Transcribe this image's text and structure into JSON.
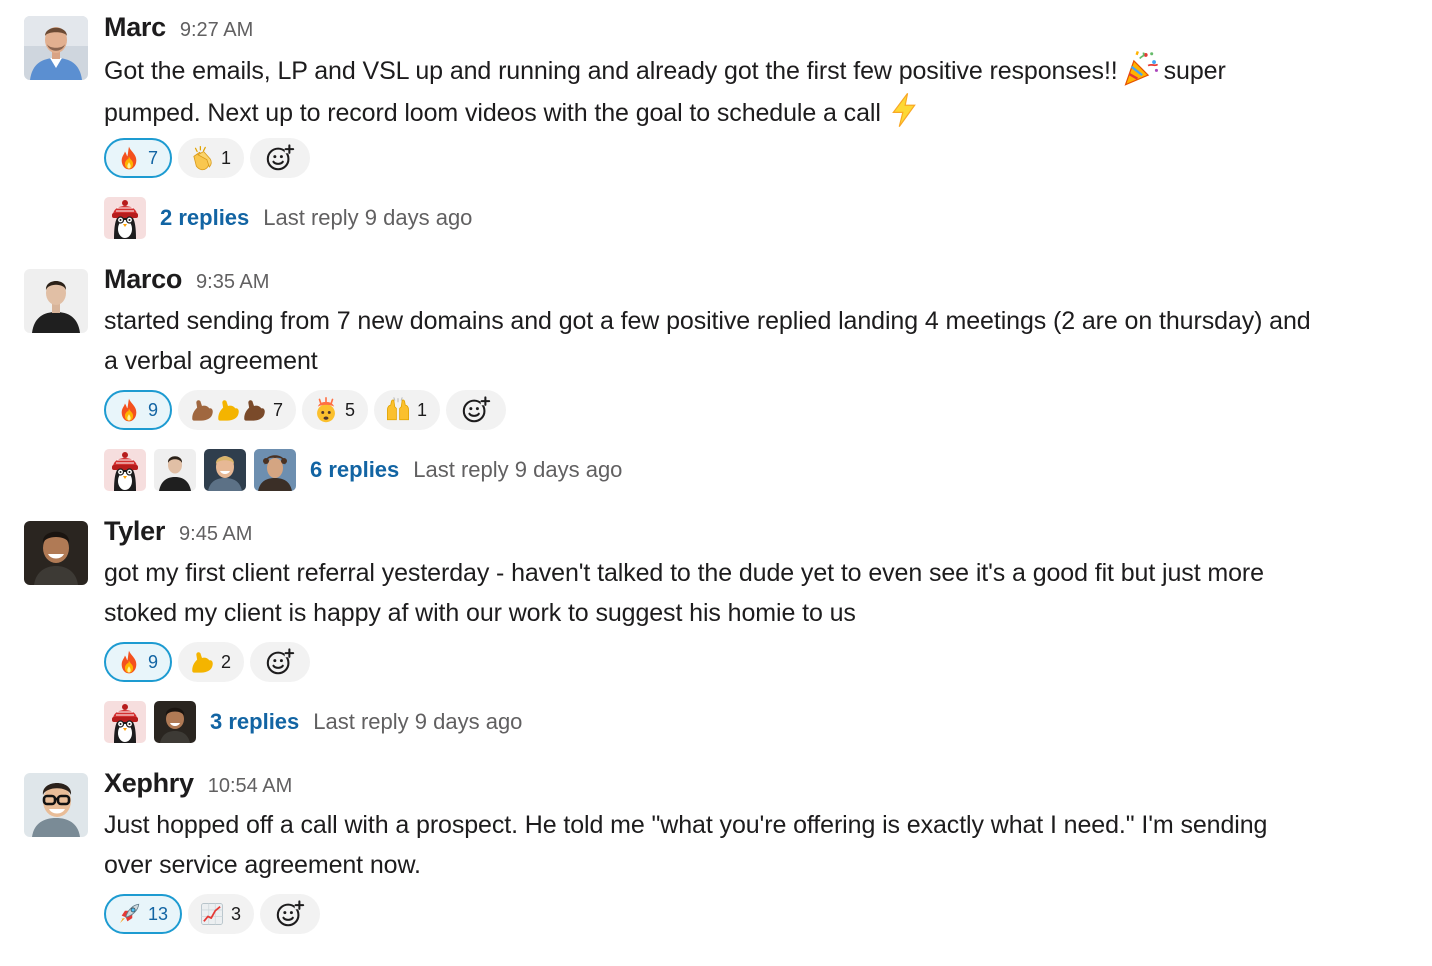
{
  "colors": {
    "link": "#1264a3",
    "reaction_mine_border": "#1d9bd1",
    "reaction_mine_bg": "#e8f5fa",
    "reaction_bg": "#f2f2f2",
    "meta_text": "#616061"
  },
  "messages": [
    {
      "name": "Marc",
      "time": "9:27 AM",
      "avatar_icon": "man-in-blue-shirt-avatar",
      "line1": "Got the emails, LP and VSL up and running and already got the first few positive responses!!",
      "line1b": "super",
      "line2": "pumped. Next up to record loom videos with the goal to schedule a call",
      "inline_emoji": [
        "party-popper-icon",
        "lightning-bolt-icon"
      ],
      "reactions": [
        {
          "emoji": "fire-icon",
          "count": "7",
          "mine": true
        },
        {
          "emoji": "clapping-hands-icon",
          "count": "1",
          "mine": false
        }
      ],
      "reply_count": "2 replies",
      "last_reply": "Last reply 9 days ago",
      "reply_avatars": [
        "penguin-beanie-avatar"
      ]
    },
    {
      "name": "Marco",
      "time": "9:35 AM",
      "avatar_icon": "man-in-black-shirt-avatar",
      "line1": "started sending from 7 new domains and got a few positive replied landing 4 meetings (2 are on thursday) and",
      "line2": "a verbal agreement",
      "reactions": [
        {
          "emoji": "fire-icon",
          "count": "9",
          "mine": true
        },
        {
          "emoji": "flexed-biceps-trio-icon",
          "count": "7",
          "mine": false
        },
        {
          "emoji": "exploding-head-icon",
          "count": "5",
          "mine": false
        },
        {
          "emoji": "raising-hands-icon",
          "count": "1",
          "mine": false
        }
      ],
      "reply_count": "6 replies",
      "last_reply": "Last reply 9 days ago",
      "reply_avatars": [
        "penguin-beanie-avatar",
        "man-in-black-shirt-avatar",
        "blond-man-avatar",
        "curly-hair-man-avatar"
      ]
    },
    {
      "name": "Tyler",
      "time": "9:45 AM",
      "avatar_icon": "smiling-man-dark-avatar",
      "line1": "got my first client referral yesterday - haven't talked to the dude yet to even see it's a good fit but just more",
      "line2": "stoked my client is happy af with our work to suggest his homie to us",
      "reactions": [
        {
          "emoji": "fire-icon",
          "count": "9",
          "mine": true
        },
        {
          "emoji": "flexed-biceps-icon",
          "count": "2",
          "mine": false
        }
      ],
      "reply_count": "3 replies",
      "last_reply": "Last reply 9 days ago",
      "reply_avatars": [
        "penguin-beanie-avatar",
        "smiling-man-dark-avatar"
      ]
    },
    {
      "name": "Xephry",
      "time": "10:54 AM",
      "avatar_icon": "man-with-glasses-avatar",
      "line1": "Just hopped off a call with a prospect. He told me \"what you're offering is exactly what I need.\"  I'm sending",
      "line2": "over service agreement now.",
      "reactions": [
        {
          "emoji": "rocket-icon",
          "count": "13",
          "mine": true
        },
        {
          "emoji": "chart-increasing-icon",
          "count": "3",
          "mine": false
        }
      ]
    }
  ],
  "add_reaction_icon": "add-emoji-icon"
}
